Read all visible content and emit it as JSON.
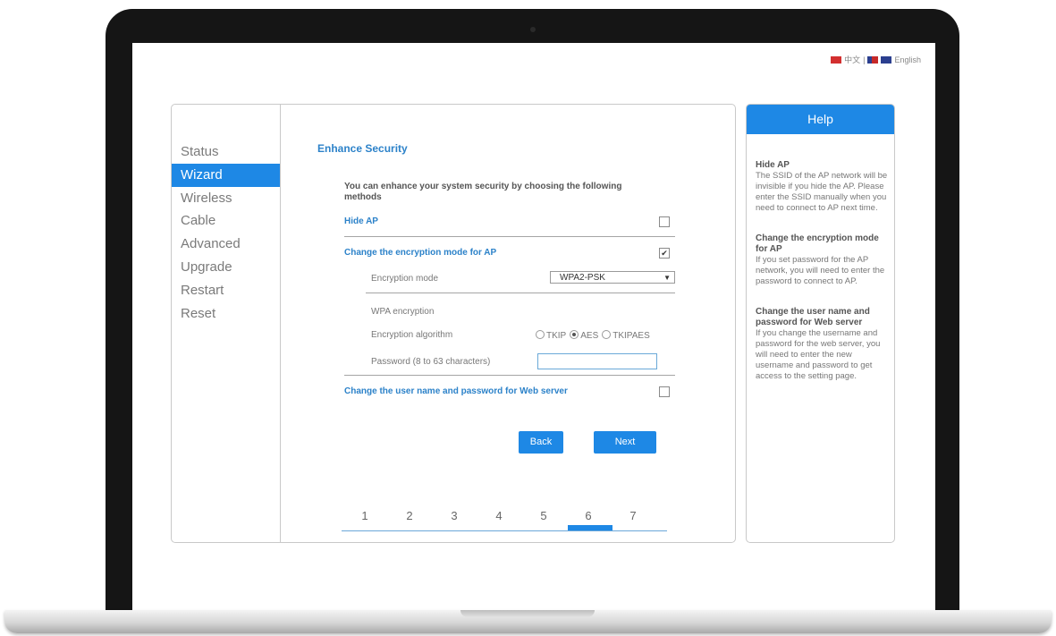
{
  "language_bar": {
    "chinese_label": "中文",
    "english_label": "English"
  },
  "sidebar": {
    "items": [
      {
        "label": "Status"
      },
      {
        "label": "Wizard"
      },
      {
        "label": "Wireless"
      },
      {
        "label": "Cable"
      },
      {
        "label": "Advanced"
      },
      {
        "label": "Upgrade"
      },
      {
        "label": "Restart"
      },
      {
        "label": "Reset"
      }
    ],
    "active": "Wizard"
  },
  "main": {
    "title": "Enhance Security",
    "intro": "You can enhance your system security by choosing the following methods",
    "hide_ap": {
      "label": "Hide AP",
      "checked": false
    },
    "encryption": {
      "label": "Change the encryption mode for AP",
      "checked": true,
      "mode_label": "Encryption mode",
      "mode_value": "WPA2-PSK",
      "wpa_label": "WPA encryption",
      "algorithm_label": "Encryption algorithm",
      "algorithms": [
        "TKIP",
        "AES",
        "TKIPAES"
      ],
      "algorithm_selected": "AES",
      "password_label": "Password (8 to 63 characters)",
      "password_value": ""
    },
    "web_user": {
      "label": "Change the user name and password for Web server",
      "checked": false
    },
    "buttons": {
      "back": "Back",
      "next": "Next"
    },
    "steps": [
      "1",
      "2",
      "3",
      "4",
      "5",
      "6",
      "7"
    ],
    "current_step": 6
  },
  "help": {
    "title": "Help",
    "sections": [
      {
        "heading": "Hide AP",
        "text": "The SSID of the AP network will be invisible if you hide the AP. Please enter the SSID manually when you need to connect to AP next time."
      },
      {
        "heading": "Change the encryption mode for AP",
        "text": "If you set password for the AP network, you will need to enter the password to connect to AP."
      },
      {
        "heading": "Change the user name and password for Web server",
        "text": "If you change the username and password for the web server, you will need to enter the new username and password to get access to the setting page."
      }
    ]
  },
  "colors": {
    "accent": "#1e88e5",
    "title_blue": "#2c82c9",
    "bezel": "#151515"
  }
}
